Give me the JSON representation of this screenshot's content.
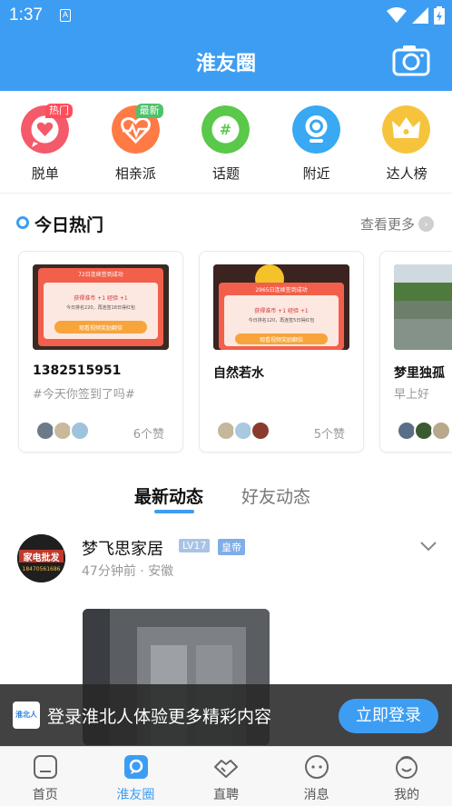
{
  "status_bar": {
    "time": "1:37",
    "indicator": "A"
  },
  "header": {
    "title": "淮友圈",
    "camera_icon": "camera-icon"
  },
  "categories": [
    {
      "label": "脱单",
      "badge": "热门",
      "badge_color": "#ff4d5a",
      "color": "#f55a6a",
      "icon": "heart-icon"
    },
    {
      "label": "相亲派",
      "badge": "最新",
      "badge_color": "#4fc26b",
      "color": "#ff7a45",
      "icon": "heartbeat-icon"
    },
    {
      "label": "话题",
      "badge": "",
      "color": "#5ac84a",
      "icon": "hashtag-icon"
    },
    {
      "label": "附近",
      "badge": "",
      "color": "#38a9f2",
      "icon": "location-icon"
    },
    {
      "label": "达人榜",
      "badge": "",
      "color": "#f6c43c",
      "icon": "crown-icon"
    }
  ],
  "hot": {
    "title": "今日热门",
    "more": "查看更多",
    "cards": [
      {
        "name": "1382515951",
        "subtitle": "#今天你签到了吗#",
        "likes": "6个赞",
        "img_title": "72日连续签到成功",
        "img_line1": "获得淮币 +1  经验 +1",
        "img_line2": "今日排名220，再连签18日得红包",
        "img_button": "观看视频奖励翻倍"
      },
      {
        "name": "自然若水",
        "subtitle": "",
        "likes": "5个赞",
        "img_title": "2965日连续签到成功",
        "img_line1": "获得淮币 +1  经验 +1",
        "img_line2": "今日排名120，再连签5日得红包",
        "img_button": "观看视频奖励翻倍"
      },
      {
        "name": "梦里独孤",
        "subtitle": "早上好",
        "likes": ""
      }
    ]
  },
  "tabs": {
    "active": "最新动态",
    "inactive": "好友动态"
  },
  "post": {
    "author": "梦飞思家居",
    "level": "LV17",
    "rank": "皇帝",
    "meta": "47分钟前 · 安徽",
    "avatar_line1": "家电批发",
    "avatar_line2": "18470561686"
  },
  "banner": {
    "logo_text": "淮北人",
    "text": "登录淮北人体验更多精彩内容",
    "button": "立即登录"
  },
  "nav": [
    {
      "label": "首页",
      "icon": "home-icon",
      "active": false
    },
    {
      "label": "淮友圈",
      "icon": "chat-bubble-icon",
      "active": true
    },
    {
      "label": "直聘",
      "icon": "handshake-icon",
      "active": false
    },
    {
      "label": "消息",
      "icon": "message-icon",
      "active": false
    },
    {
      "label": "我的",
      "icon": "profile-icon",
      "active": false
    }
  ],
  "colors": {
    "primary": "#3d9df2",
    "banner_bg": "#2b2b2b"
  }
}
